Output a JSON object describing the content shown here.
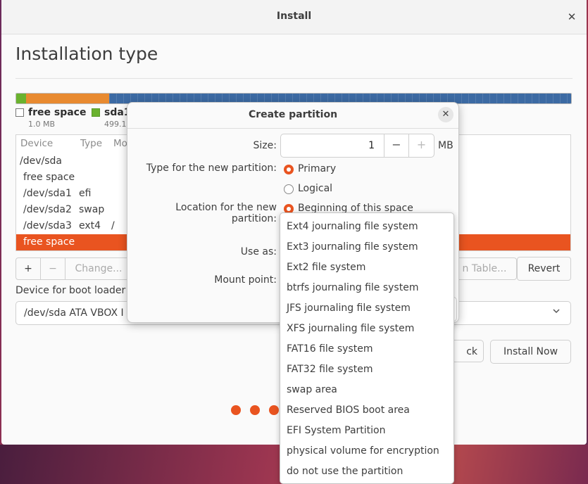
{
  "window": {
    "title": "Install",
    "close_glyph": "✕"
  },
  "page": {
    "heading": "Installation type"
  },
  "legend": [
    {
      "name": "free space",
      "size": "1.0 MB",
      "color": "#ffffff"
    },
    {
      "name": "sda1",
      "size": "499.1",
      "color": "#6ab22e"
    }
  ],
  "table": {
    "headers": {
      "device": "Device",
      "type": "Type",
      "mount": "Mo"
    },
    "rows": [
      {
        "device": "/dev/sda",
        "type": "",
        "mount": ""
      },
      {
        "device": "free space",
        "type": "",
        "mount": ""
      },
      {
        "device": "/dev/sda1",
        "type": "efi",
        "mount": ""
      },
      {
        "device": "/dev/sda2",
        "type": "swap",
        "mount": ""
      },
      {
        "device": "/dev/sda3",
        "type": "ext4",
        "mount": "/"
      },
      {
        "device": "free space",
        "type": "",
        "mount": ""
      }
    ]
  },
  "toolbar": {
    "add": "+",
    "remove": "−",
    "change": "Change...",
    "new_table": "n Table...",
    "revert": "Revert"
  },
  "boot_loader": {
    "label": "Device for boot loader i",
    "value": "/dev/sda    ATA VBOX I"
  },
  "nav": {
    "back": "ck",
    "install": "Install Now"
  },
  "dialog": {
    "title": "Create partition",
    "close_glyph": "✕",
    "size_label": "Size:",
    "size_value": "1",
    "minus": "−",
    "plus": "+",
    "unit": "MB",
    "type_label": "Type for the new partition:",
    "type_primary": "Primary",
    "type_logical": "Logical",
    "location_label": "Location for the new partition:",
    "location_begin": "Beginning of this space",
    "use_as_label": "Use as:",
    "mount_label": "Mount point:"
  },
  "use_as_menu": [
    "Ext4 journaling file system",
    "Ext3 journaling file system",
    "Ext2 file system",
    "btrfs journaling file system",
    "JFS journaling file system",
    "XFS journaling file system",
    "FAT16 file system",
    "FAT32 file system",
    "swap area",
    "Reserved BIOS boot area",
    "EFI System Partition",
    "physical volume for encryption",
    "do not use the partition"
  ],
  "colors": {
    "accent": "#e95420",
    "efi": "#6ab22e",
    "swap": "#e88a30",
    "ext4": "#3c6aa3"
  }
}
